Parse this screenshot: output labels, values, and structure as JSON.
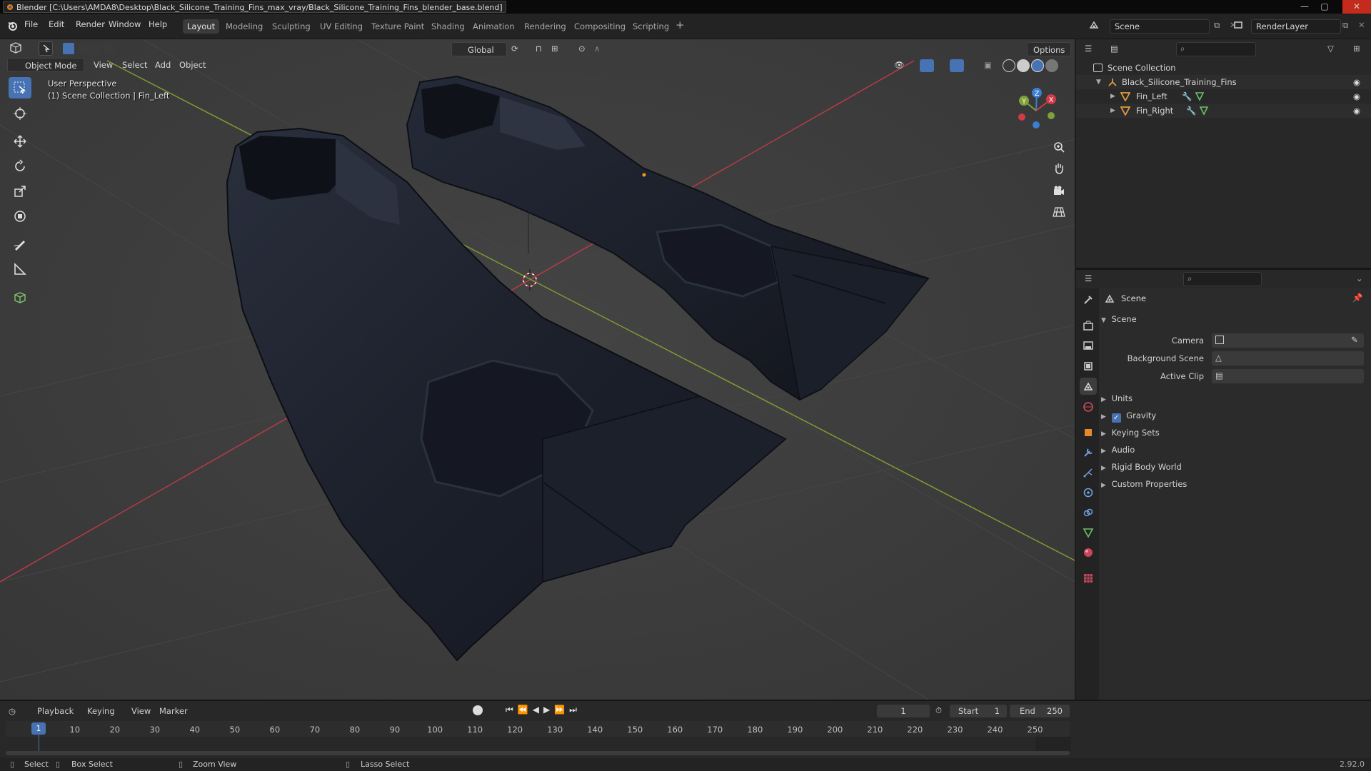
{
  "window": {
    "title": "Blender [C:\\Users\\AMDA8\\Desktop\\Black_Silicone_Training_Fins_max_vray/Black_Silicone_Training_Fins_blender_base.blend]"
  },
  "menu": [
    "File",
    "Edit",
    "Render",
    "Window",
    "Help"
  ],
  "workspaces": [
    "Layout",
    "Modeling",
    "Sculpting",
    "UV Editing",
    "Texture Paint",
    "Shading",
    "Animation",
    "Rendering",
    "Compositing",
    "Scripting"
  ],
  "active_workspace": "Layout",
  "scene_field": "Scene",
  "layer_field": "RenderLayer",
  "viewport": {
    "mode": "Object Mode",
    "menus": [
      "View",
      "Select",
      "Add",
      "Object"
    ],
    "transform_orientation": "Global",
    "options_label": "Options",
    "overlay_line1": "User Perspective",
    "overlay_line2": "(1) Scene Collection | Fin_Left",
    "gizmo_axes": {
      "x": "X",
      "y": "Y",
      "z": "Z"
    }
  },
  "outliner": {
    "root": "Scene Collection",
    "collection": "Black_Silicone_Training_Fins",
    "objects": [
      "Fin_Left",
      "Fin_Right"
    ]
  },
  "properties": {
    "header": "Scene",
    "panel": "Scene",
    "fields": {
      "camera": "Camera",
      "background_scene": "Background Scene",
      "active_clip": "Active Clip"
    },
    "subpanels": [
      "Units",
      "Gravity",
      "Keying Sets",
      "Audio",
      "Rigid Body World",
      "Custom Properties"
    ],
    "gravity_enabled": true
  },
  "timeline": {
    "menus": [
      "Playback",
      "Keying",
      "View",
      "Marker"
    ],
    "current_frame": "1",
    "start_label": "Start",
    "start": "1",
    "end_label": "End",
    "end": "250",
    "ticks": [
      "1",
      "10",
      "20",
      "30",
      "40",
      "50",
      "60",
      "70",
      "80",
      "90",
      "100",
      "110",
      "120",
      "130",
      "140",
      "150",
      "160",
      "170",
      "180",
      "190",
      "200",
      "210",
      "220",
      "230",
      "240",
      "250"
    ]
  },
  "status": {
    "select": "Select",
    "box_select": "Box Select",
    "zoom_view": "Zoom View",
    "lasso_select": "Lasso Select",
    "version": "2.92.0"
  },
  "colors": {
    "accent": "#4772b3",
    "x_axis": "#d03a4a",
    "y_axis": "#7fa238",
    "z_axis": "#3a7fd4",
    "fin": "#1e2230"
  }
}
